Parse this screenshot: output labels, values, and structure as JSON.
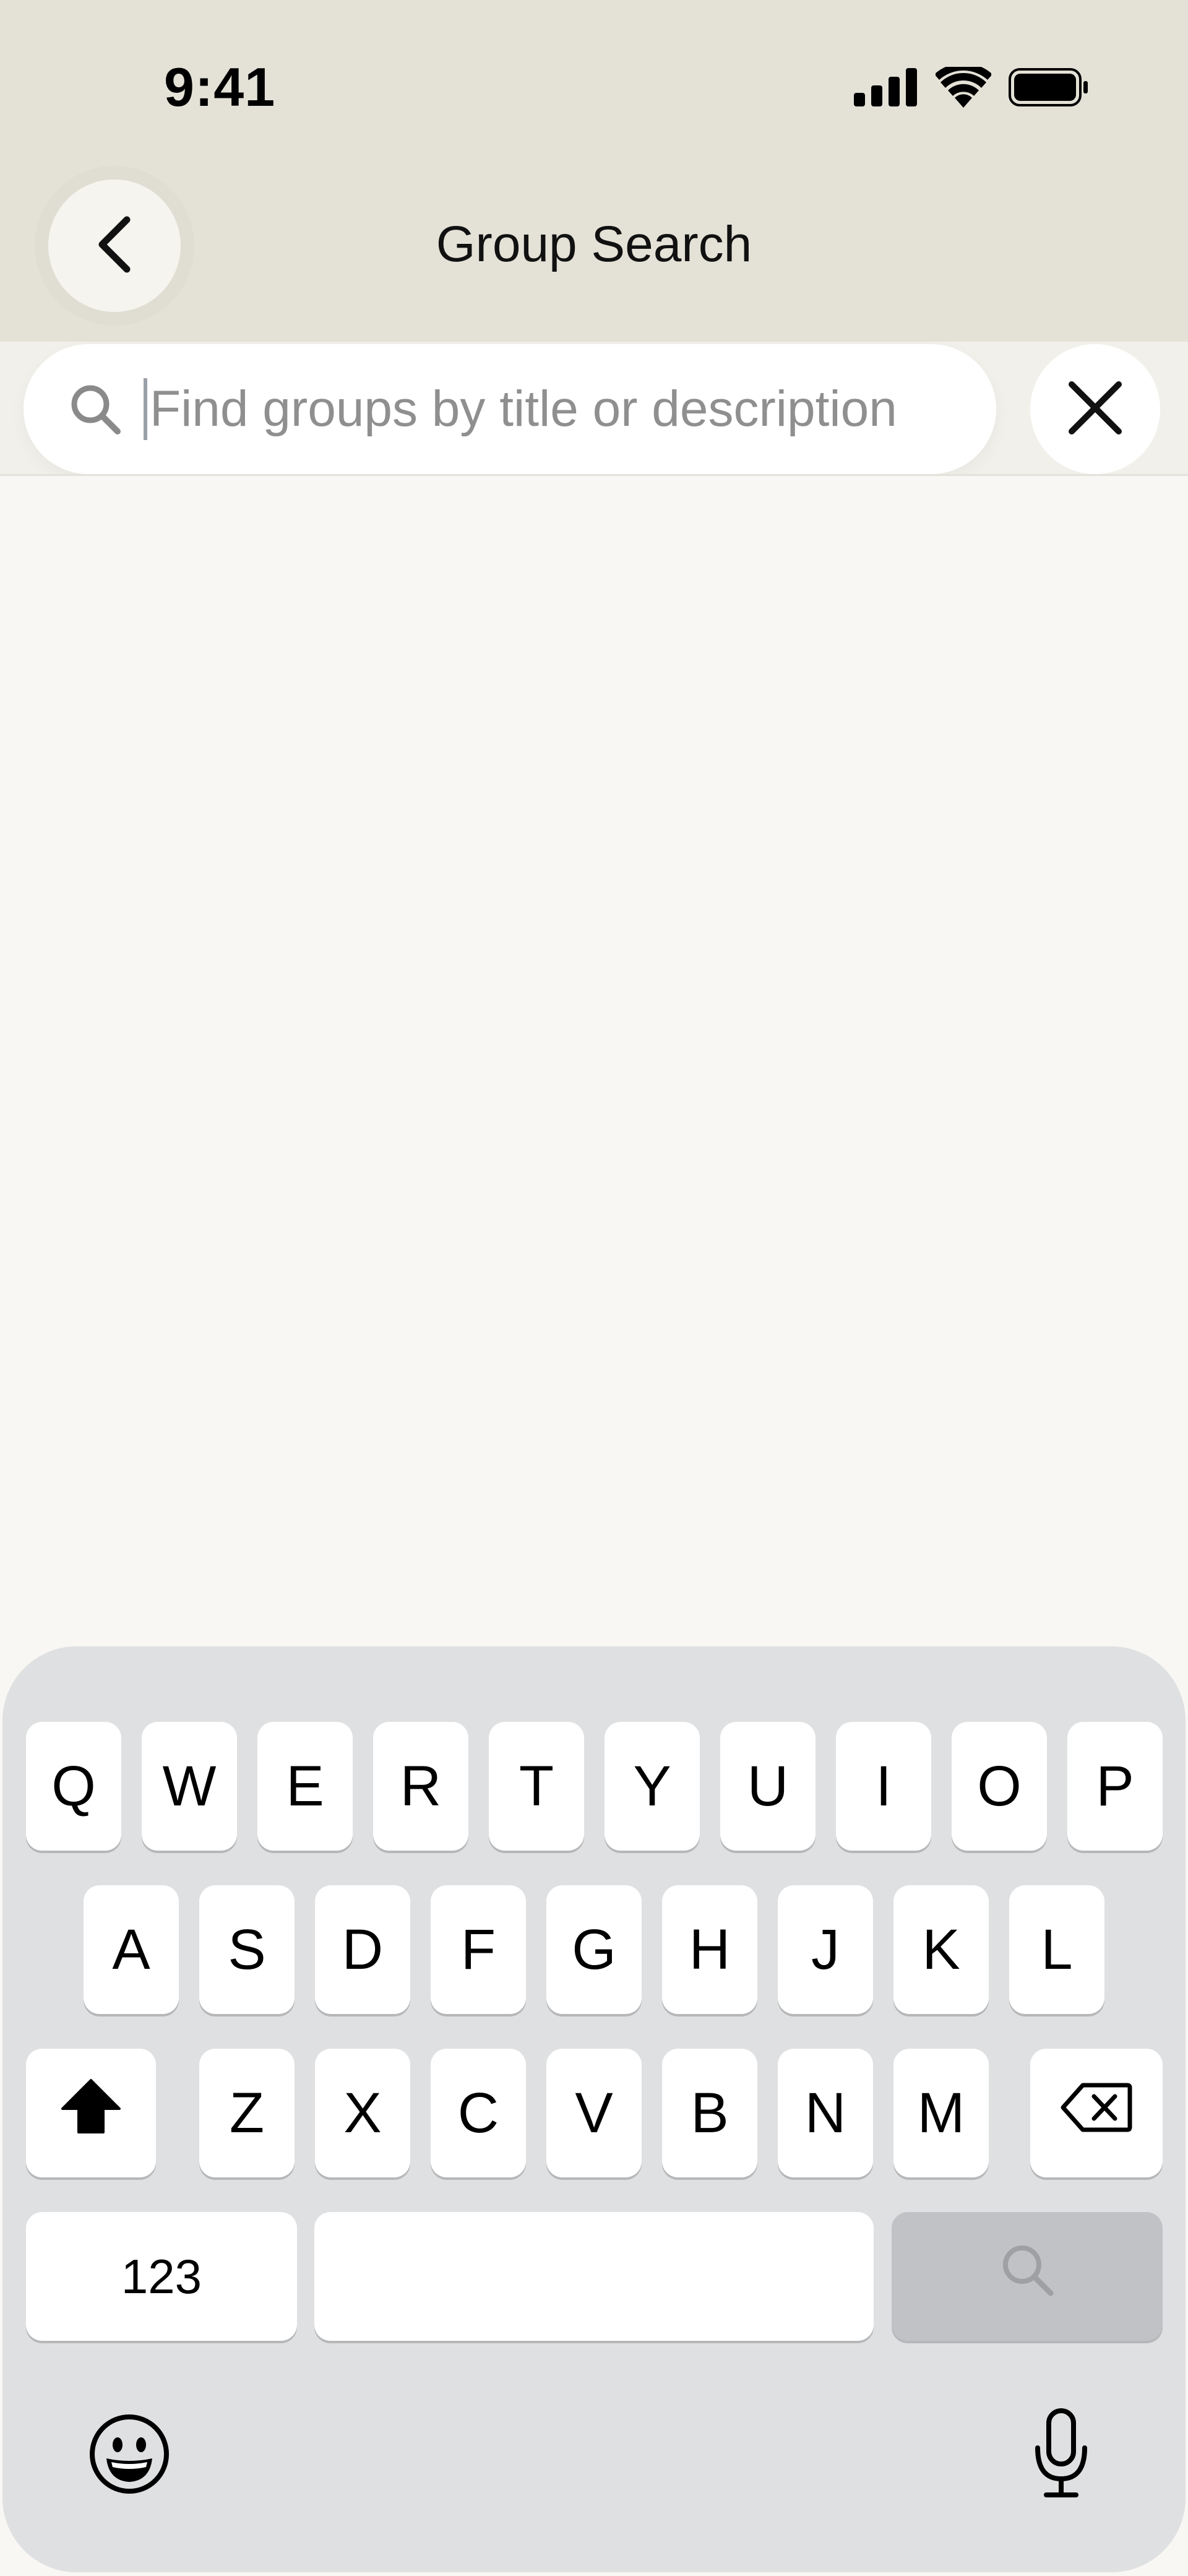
{
  "status_bar": {
    "time": "9:41",
    "icons": [
      "cellular-signal-icon",
      "wifi-icon",
      "battery-icon"
    ]
  },
  "header": {
    "title": "Group Search",
    "back_icon": "chevron-left-icon"
  },
  "search": {
    "placeholder": "Find groups by title or description",
    "value": "",
    "search_icon": "magnifier-icon",
    "clear_icon": "close-icon"
  },
  "keyboard": {
    "row1": [
      "Q",
      "W",
      "E",
      "R",
      "T",
      "Y",
      "U",
      "I",
      "O",
      "P"
    ],
    "row2": [
      "A",
      "S",
      "D",
      "F",
      "G",
      "H",
      "J",
      "K",
      "L"
    ],
    "row3": [
      "Z",
      "X",
      "C",
      "V",
      "B",
      "N",
      "M"
    ],
    "numbers_label": "123",
    "shift_icon": "shift-icon",
    "delete_icon": "backspace-icon",
    "return_icon": "search-icon",
    "emoji_icon": "emoji-icon",
    "mic_icon": "microphone-icon"
  },
  "colors": {
    "header_background": "#e4e2d7",
    "page_background": "#f8f7f3",
    "keyboard_background": "#dfe0e2",
    "search_key": "#c1c2c6",
    "placeholder": "#8f8f8f"
  }
}
